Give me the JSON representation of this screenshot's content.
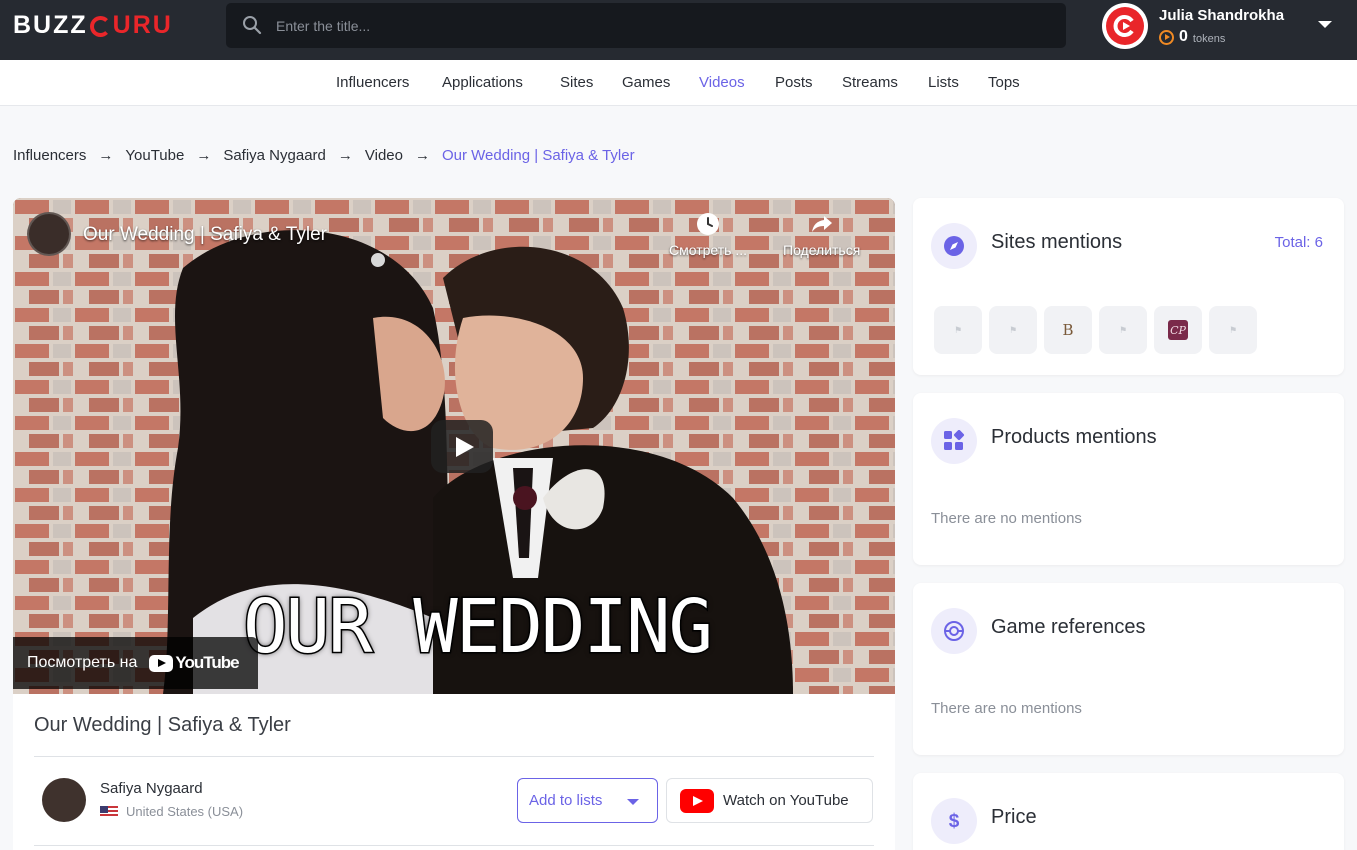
{
  "header": {
    "logo_buzz": "BUZZ",
    "logo_guru": "URU",
    "search_placeholder": "Enter the title...",
    "user_name": "Julia Shandrokha",
    "tokens_count": "0",
    "tokens_label": "tokens"
  },
  "nav": {
    "items": [
      {
        "label": "Influencers"
      },
      {
        "label": "Applications"
      },
      {
        "label": "Sites"
      },
      {
        "label": "Games"
      },
      {
        "label": "Videos",
        "active": true
      },
      {
        "label": "Posts"
      },
      {
        "label": "Streams"
      },
      {
        "label": "Lists"
      },
      {
        "label": "Tops"
      }
    ]
  },
  "breadcrumb": {
    "items": [
      "Influencers",
      "YouTube",
      "Safiya Nygaard",
      "Video",
      "Our Wedding | Safiya & Tyler"
    ],
    "separator": "→"
  },
  "video": {
    "overlay_title": "Our Wedding | Safiya & Tyler",
    "watch_later": "Смотреть ...",
    "share": "Поделиться",
    "thumbnail_text": "OUR WEDDING",
    "watch_on": "Посмотреть на",
    "youtube_word": "YouTube"
  },
  "info": {
    "title": "Our Wedding | Safiya & Tyler",
    "channel_name": "Safiya Nygaard",
    "country": "United States (USA)",
    "add_to_lists": "Add to lists",
    "watch_on_youtube": "Watch on YouTube"
  },
  "sidebar": {
    "sites_mentions": {
      "title": "Sites mentions",
      "total": "Total: 6",
      "sites": [
        "flag",
        "flag",
        "B",
        "flag",
        "CP",
        "flag"
      ]
    },
    "products_mentions": {
      "title": "Products mentions",
      "empty": "There are no mentions"
    },
    "game_references": {
      "title": "Game references",
      "empty": "There are no mentions"
    },
    "price": {
      "title": "Price"
    }
  },
  "colors": {
    "accent": "#6b63e6",
    "brand_red": "#e9262a",
    "topbar": "#262a31",
    "youtube_red": "#ff0000"
  }
}
